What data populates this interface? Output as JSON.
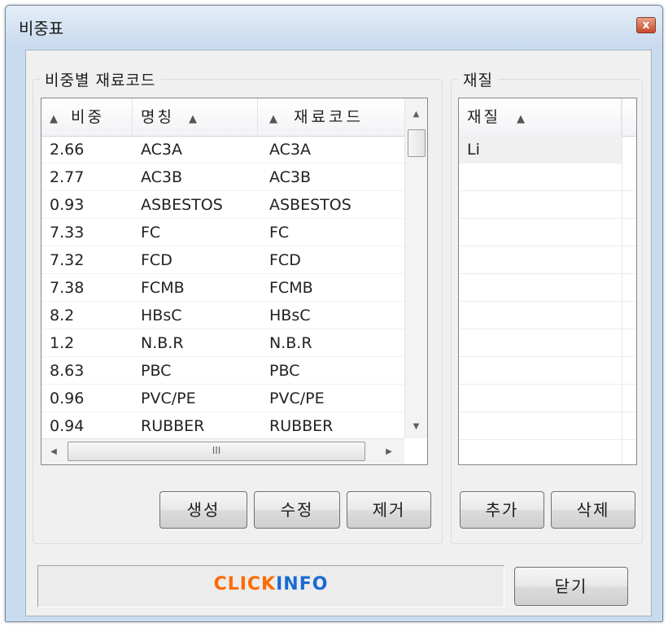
{
  "window": {
    "title": "비중표",
    "close_label": "x"
  },
  "left_group": {
    "label": "비중별 재료코드",
    "columns": [
      "비중",
      "명칭",
      "재료코드"
    ],
    "sort_arrow": "▲",
    "rows": [
      [
        "2.66",
        "AC3A",
        "AC3A"
      ],
      [
        "2.77",
        "AC3B",
        "AC3B"
      ],
      [
        "0.93",
        "ASBESTOS",
        "ASBESTOS"
      ],
      [
        "7.33",
        "FC",
        "FC"
      ],
      [
        "7.32",
        "FCD",
        "FCD"
      ],
      [
        "7.38",
        "FCMB",
        "FCMB"
      ],
      [
        "8.2",
        "HBsC",
        "HBsC"
      ],
      [
        "1.2",
        "N.B.R",
        "N.B.R"
      ],
      [
        "8.63",
        "PBC",
        "PBC"
      ],
      [
        "0.96",
        "PVC/PE",
        "PVC/PE"
      ],
      [
        "0.94",
        "RUBBER",
        "RUBBER"
      ]
    ],
    "hscroll_grip": "III",
    "buttons": {
      "create": "생성",
      "edit": "수정",
      "remove": "제거"
    }
  },
  "right_group": {
    "label": "재질",
    "column": "재질",
    "rows": [
      "Li"
    ],
    "buttons": {
      "add": "추가",
      "delete": "삭제"
    }
  },
  "footer": {
    "logo_click": "CLICK",
    "logo_info": "INFO",
    "close_button": "닫기"
  },
  "colors": {
    "logo_click": "#ff6a00",
    "logo_info": "#1a6ad4",
    "title_bar": "#c8daee",
    "client_bg": "#f0f0f0"
  },
  "icons": {
    "sort": "triangle-up-icon",
    "scroll_up": "scroll-up-arrow-icon",
    "scroll_down": "scroll-down-arrow-icon",
    "scroll_left": "scroll-left-arrow-icon",
    "scroll_right": "scroll-right-arrow-icon",
    "close": "close-icon"
  }
}
